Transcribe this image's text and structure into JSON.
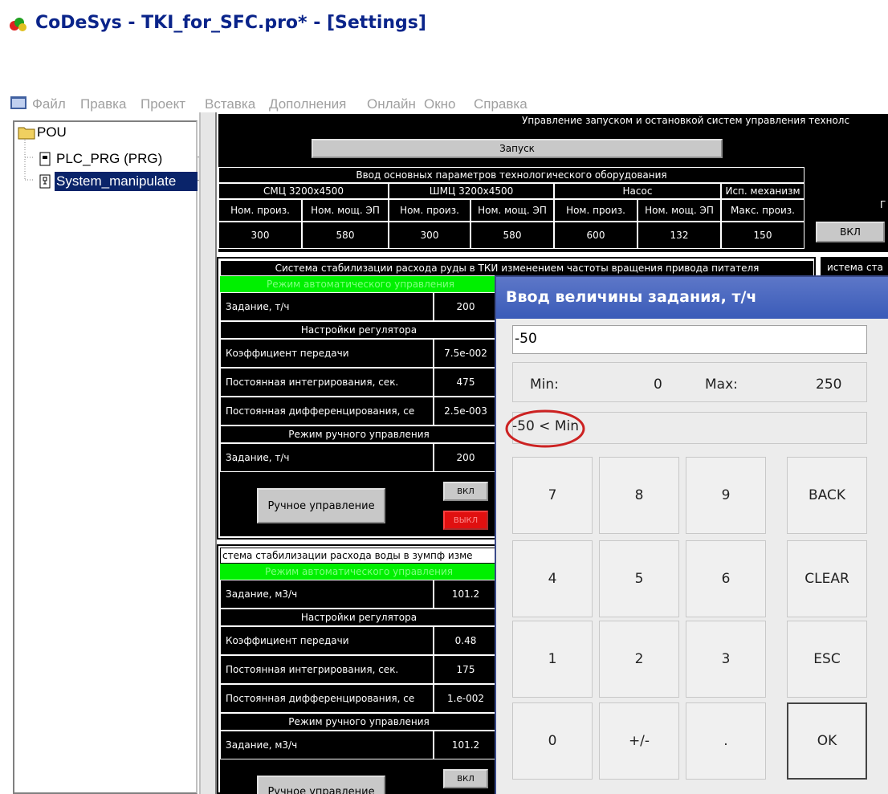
{
  "window": {
    "title": "CoDeSys - TKI_for_SFC.pro* - [Settings]"
  },
  "menu": [
    "Файл",
    "Правка",
    "Проект",
    "Вставка",
    "Дополнения",
    "Онлайн",
    "Окно",
    "Справка"
  ],
  "toolbar": [
    "new-icon",
    "open-icon",
    "save-icon",
    "calc-icon",
    "stop-icon",
    "cycle-icon",
    "login-icon",
    "print-icon",
    "print-setup-icon",
    "screen-icon"
  ],
  "tree": {
    "root": "POU",
    "items": [
      "PLC_PRG (PRG)",
      "System_manipulate"
    ]
  },
  "top": {
    "header": "Управление запуском и остановкой систем управления технолс",
    "start_btn": "Запуск",
    "params_title": "Ввод основных параметров технологического оборудования",
    "groups": [
      "СМЦ 3200x4500",
      "ШМЦ 3200x4500",
      "Насос",
      "Исп. механизм"
    ],
    "subheads": [
      "Ном. произ.",
      "Ном. мощ. ЭП",
      "Ном. произ.",
      "Ном. мощ. ЭП",
      "Ном. произ.",
      "Ном. мощ. ЭП",
      "Макс. произ."
    ],
    "values": [
      "300",
      "580",
      "300",
      "580",
      "600",
      "132",
      "150"
    ],
    "vkl": "ВКЛ",
    "side_label": "Г"
  },
  "ore": {
    "title": "Система стабилизации расхода руды в ТКИ изменением частоты вращения привода питателя",
    "auto_mode": "Режим автоматического управления",
    "rows": [
      {
        "label": "Задание, т/ч",
        "value": "200"
      },
      {
        "label": "Настройки регулятора",
        "value": ""
      },
      {
        "label": "Коэффициент передачи",
        "value": "7.5e-002"
      },
      {
        "label": "Постоянная интегрирования, сек.",
        "value": "475"
      },
      {
        "label": "Постоянная дифференцирования, се",
        "value": "2.5e-003"
      },
      {
        "label": "Режим ручного управления",
        "value": ""
      },
      {
        "label": "Задание, т/ч",
        "value": "200"
      }
    ],
    "manual_btn": "Ручное управление",
    "vkl": "ВКЛ",
    "vykl": "ВЫКЛ",
    "side_title": "истема ста"
  },
  "water": {
    "title": "стема стабилизации расхода воды в зумпф изме",
    "auto_mode": "Режим автоматического управления",
    "rows": [
      {
        "label": "Задание, м3/ч",
        "value": "101.2"
      },
      {
        "label": "Настройки регулятора",
        "value": ""
      },
      {
        "label": "Коэффициент передачи",
        "value": "0.48"
      },
      {
        "label": "Постоянная интегрирования, сек.",
        "value": "175"
      },
      {
        "label": "Постоянная дифференцирования, се",
        "value": "1.e-002"
      },
      {
        "label": "Режим ручного управления",
        "value": ""
      },
      {
        "label": "Задание, м3/ч",
        "value": "101.2"
      }
    ],
    "manual_btn": "Ручное управление",
    "vkl": "ВКЛ"
  },
  "dialog": {
    "title": "Ввод величины задания, т/ч",
    "input": "-50",
    "min_label": "Min:",
    "min": "0",
    "max_label": "Max:",
    "max": "250",
    "error": "-50 < Min",
    "keys": [
      "7",
      "8",
      "9",
      "BACK",
      "4",
      "5",
      "6",
      "CLEAR",
      "1",
      "2",
      "3",
      "ESC",
      "0",
      "+/-",
      ".",
      "OK"
    ]
  },
  "colors": {
    "title_blue": "#0a248a",
    "green": "#00f000",
    "dialog_header": "#4a66c0",
    "red_circle": "#cc2222"
  }
}
